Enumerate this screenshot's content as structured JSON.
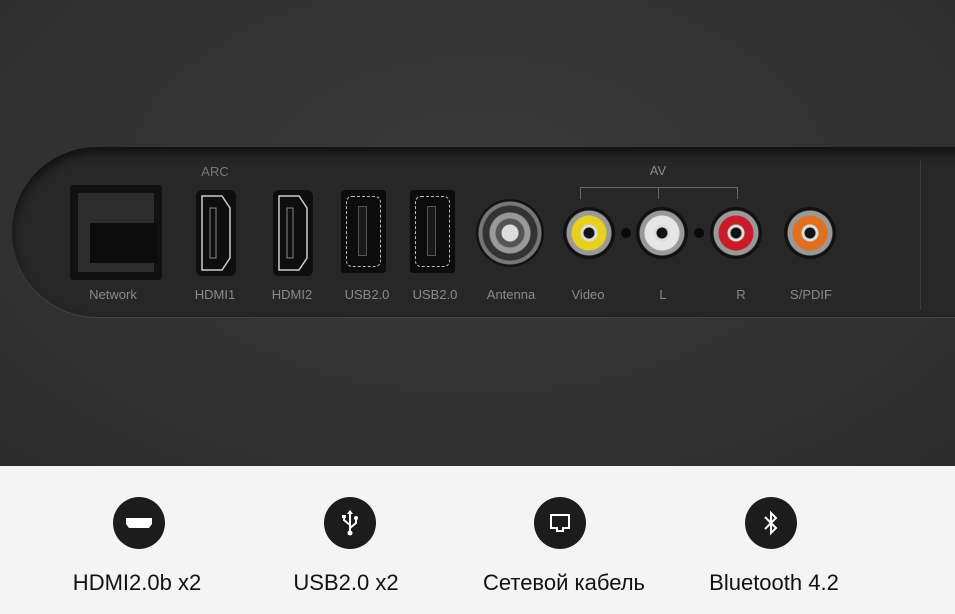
{
  "ports": {
    "network": "Network",
    "arc": "ARC",
    "hdmi1": "HDMI1",
    "hdmi2": "HDMI2",
    "usb1": "USB2.0",
    "usb2": "USB2.0",
    "antenna": "Antenna",
    "av": "AV",
    "video": "Video",
    "l": "L",
    "r": "R",
    "spdif": "S/PDIF"
  },
  "jack_colors": {
    "video": "#e8d020",
    "l": "#e6e6e6",
    "r": "#c81c28",
    "spdif": "#e07020"
  },
  "features": [
    {
      "icon": "hdmi-icon",
      "label": "HDMI2.0b x2"
    },
    {
      "icon": "usb-icon",
      "label": "USB2.0 x2"
    },
    {
      "icon": "ethernet-icon",
      "label": "Сетевой кабель"
    },
    {
      "icon": "bluetooth-icon",
      "label": "Bluetooth 4.2"
    }
  ]
}
